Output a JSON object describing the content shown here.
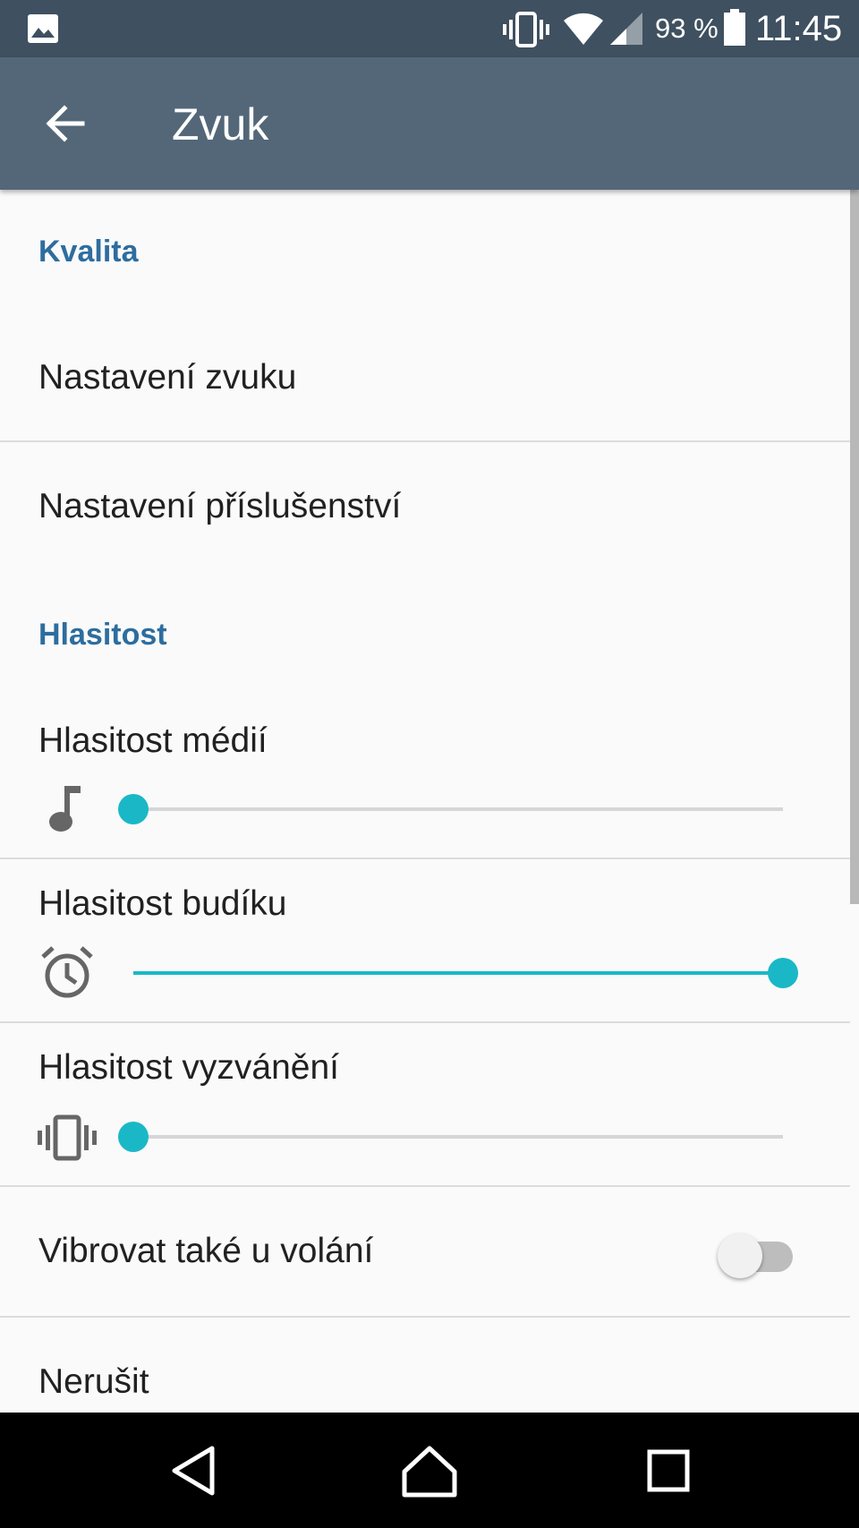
{
  "status_bar": {
    "battery_percent": "93 %",
    "time": "11:45",
    "icons": [
      "image-notification-icon",
      "vibrate-icon",
      "wifi-icon",
      "cell-signal-icon",
      "battery-icon"
    ]
  },
  "app_bar": {
    "title": "Zvuk",
    "back_icon": "arrow-back-icon"
  },
  "sections": {
    "quality": {
      "header": "Kvalita",
      "items": [
        {
          "label": "Nastavení zvuku"
        },
        {
          "label": "Nastavení příslušenství"
        }
      ]
    },
    "volume": {
      "header": "Hlasitost",
      "sliders": [
        {
          "label": "Hlasitost médií",
          "icon": "music-note-icon",
          "level": 0.0
        },
        {
          "label": "Hlasitost budíku",
          "icon": "alarm-clock-icon",
          "level": 1.0
        },
        {
          "label": "Hlasitost vyzvánění",
          "icon": "vibrate-icon",
          "level": 0.0
        }
      ],
      "toggles": [
        {
          "label": "Vibrovat také u volání",
          "on": false
        }
      ],
      "items": [
        {
          "label": "Nerušit"
        }
      ]
    }
  },
  "nav_bar": {
    "buttons": [
      "back-triangle-icon",
      "home-icon",
      "recents-icon"
    ]
  },
  "colors": {
    "status_bar": "#3f5060",
    "app_bar": "#536778",
    "section_header": "#2d6d9f",
    "accent": "#1ab8c6",
    "background": "#fafafa"
  }
}
